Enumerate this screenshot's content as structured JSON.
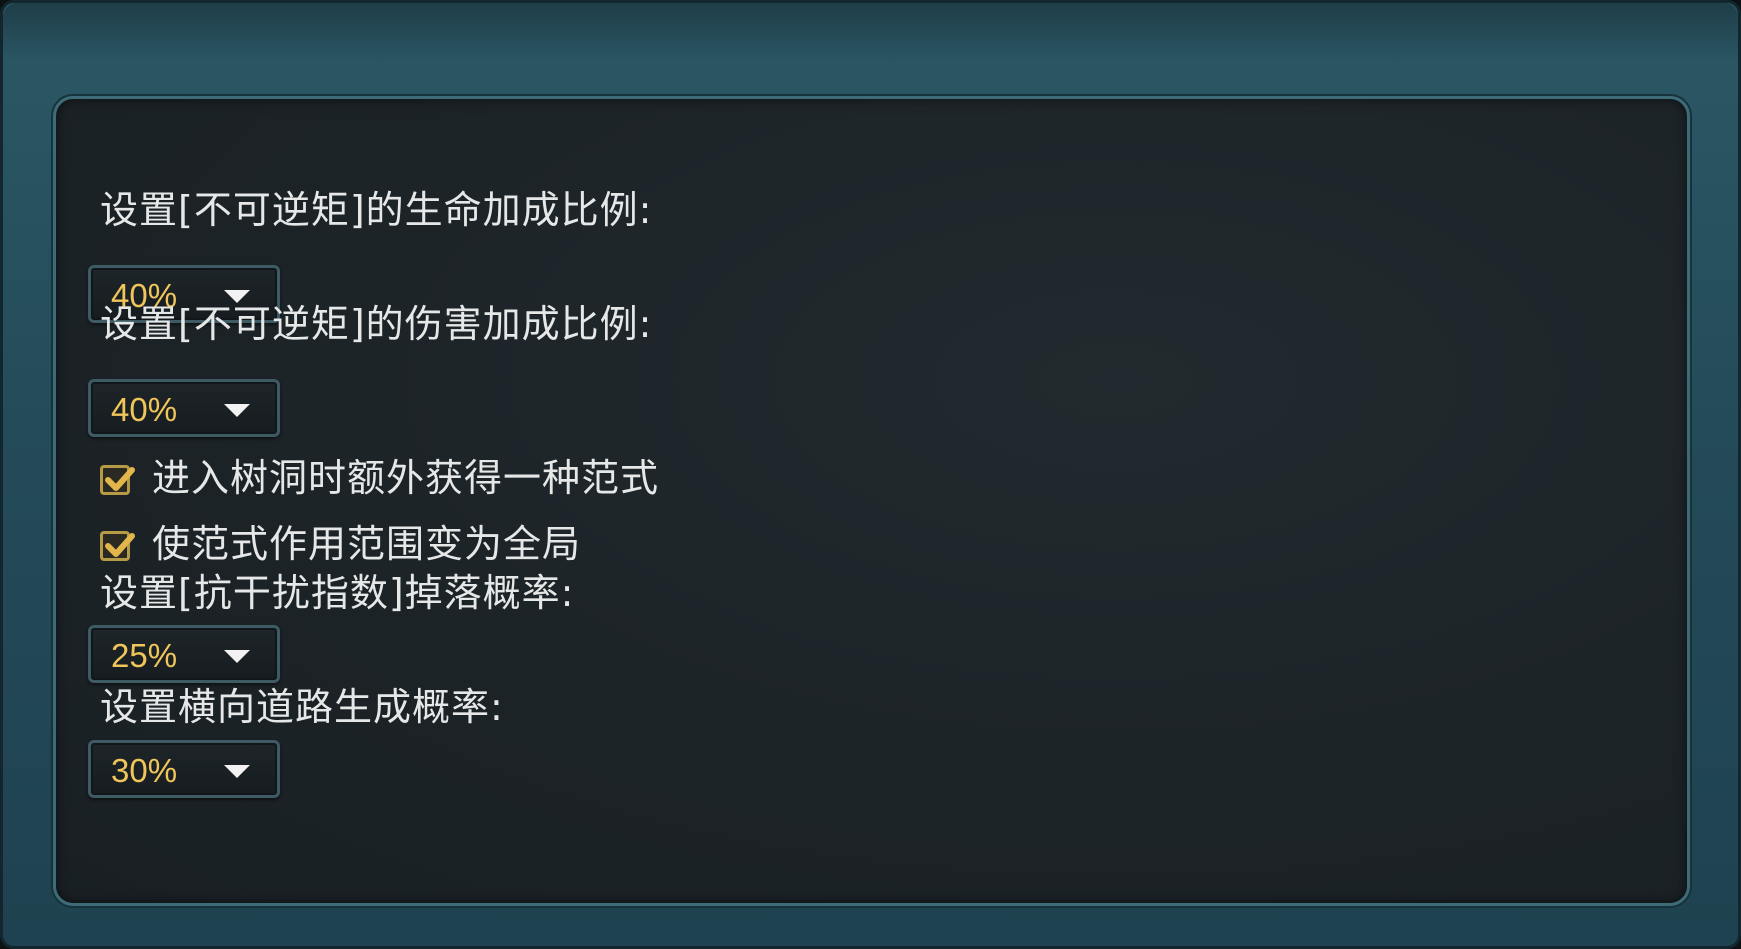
{
  "settings": {
    "hp_bonus": {
      "label": "设置[不可逆矩]的生命加成比例:",
      "value": "40%"
    },
    "damage_bonus": {
      "label": "设置[不可逆矩]的伤害加成比例:",
      "value": "40%"
    },
    "extra_paradigm": {
      "label": "进入树洞时额外获得一种范式",
      "checked": true
    },
    "global_paradigm": {
      "label": "使范式作用范围变为全局",
      "checked": true
    },
    "anti_interference_drop": {
      "label": "设置[抗干扰指数]掉落概率:",
      "value": "25%"
    },
    "horizontal_road": {
      "label": "设置横向道路生成概率:",
      "value": "30%"
    }
  },
  "colors": {
    "value_text": "#f0c55a",
    "label_text": "#e6e8e8",
    "panel_bg": "#1c2327",
    "frame": "#244b58",
    "checkbox_border": "#b79a45"
  },
  "icons": {
    "dropdown": "caret-down-icon",
    "check": "checkmark-icon"
  }
}
